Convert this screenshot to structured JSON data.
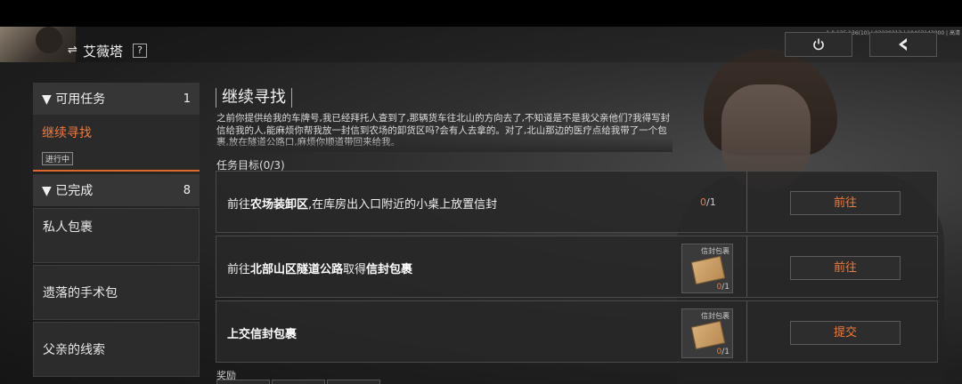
{
  "header": {
    "character_name": "艾薇塔",
    "help_label": "?",
    "swap_icon": "swap-icon",
    "version": "1.0.135.136(10) | 02220213 | 10463143000 | 高清"
  },
  "sidebar": {
    "available": {
      "label": "▼ 可用任务",
      "count": "1"
    },
    "active_task": {
      "label": "继续寻找",
      "status": "进行中"
    },
    "completed": {
      "label": "▼ 已完成",
      "count": "8"
    },
    "completed_items": [
      "私人包裹",
      "遗落的手术包",
      "父亲的线索"
    ]
  },
  "task": {
    "title": "继续寻找",
    "description": "之前你提供给我的车牌号,我已经拜托人查到了,那辆货车往北山的方向去了,不知道是不是我父亲他们?我得写封信给我的人,能麻烦你帮我放一封信到农场的卸货区吗?会有人去拿的。对了,北山那边的医疗点给我带了一个包裹,放在隧道公路口,麻烦你顺道带回来给我。",
    "objectives_label": "任务目标(0/3)",
    "objectives": [
      {
        "prefix": "前往",
        "bold": "农场装卸区",
        "suffix": ",在库房出入口附近的小桌上放置信封",
        "current": "0",
        "total": "/1",
        "button": "前往",
        "has_item": false
      },
      {
        "prefix": "前往",
        "bold": "北部山区隧道公路",
        "suffix": "取得",
        "bold2": "信封包裹",
        "current": "0",
        "total": "/1",
        "button": "前往",
        "has_item": true,
        "item_label": "信封包裹"
      },
      {
        "prefix": "",
        "bold": "上交信封包裹",
        "suffix": "",
        "current": "0",
        "total": "/1",
        "button": "提交",
        "has_item": true,
        "item_label": "信封包裹"
      }
    ],
    "rewards_label": "奖励"
  }
}
